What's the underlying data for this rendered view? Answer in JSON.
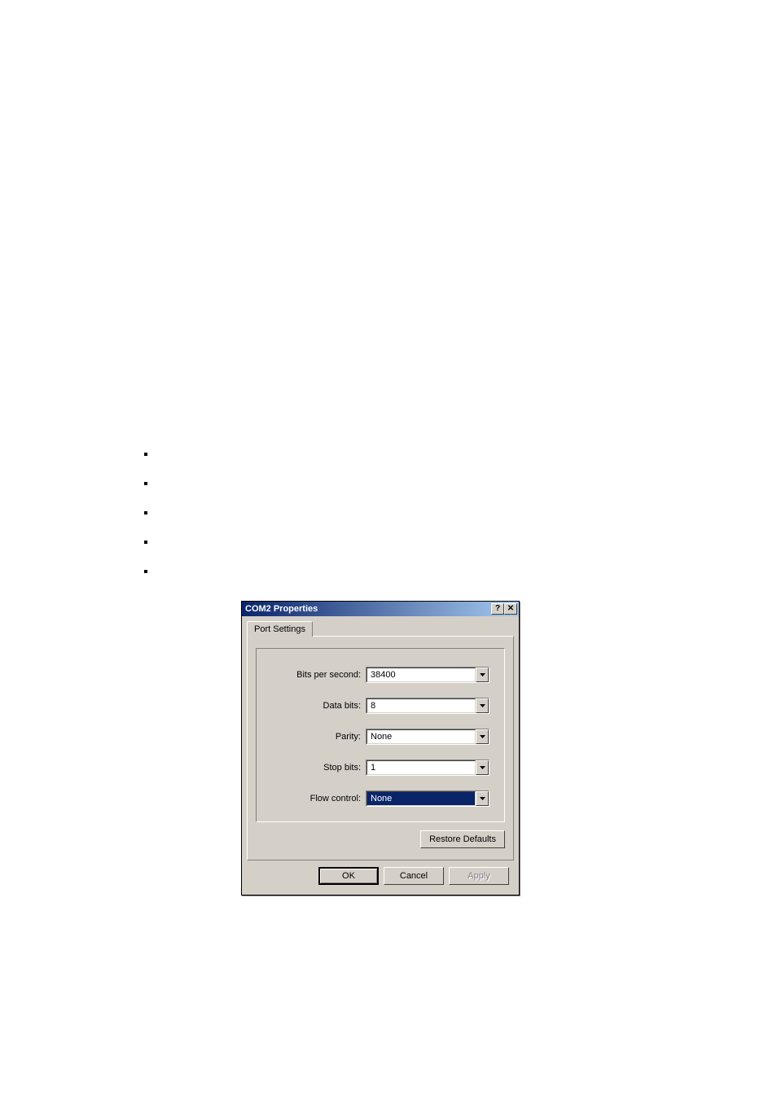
{
  "bullets_y": [
    556,
    592,
    628,
    664,
    700
  ],
  "dialog": {
    "title": "COM2 Properties",
    "tab": "Port Settings",
    "fields": {
      "bits_per_second": {
        "label": "Bits per second:",
        "value": "38400"
      },
      "data_bits": {
        "label": "Data bits:",
        "value": "8"
      },
      "parity": {
        "label": "Parity:",
        "value": "None"
      },
      "stop_bits": {
        "label": "Stop bits:",
        "value": "1"
      },
      "flow_control": {
        "label": "Flow control:",
        "value": "None"
      }
    },
    "restore_defaults": "Restore Defaults",
    "buttons": {
      "ok": "OK",
      "cancel": "Cancel",
      "apply": "Apply"
    }
  }
}
